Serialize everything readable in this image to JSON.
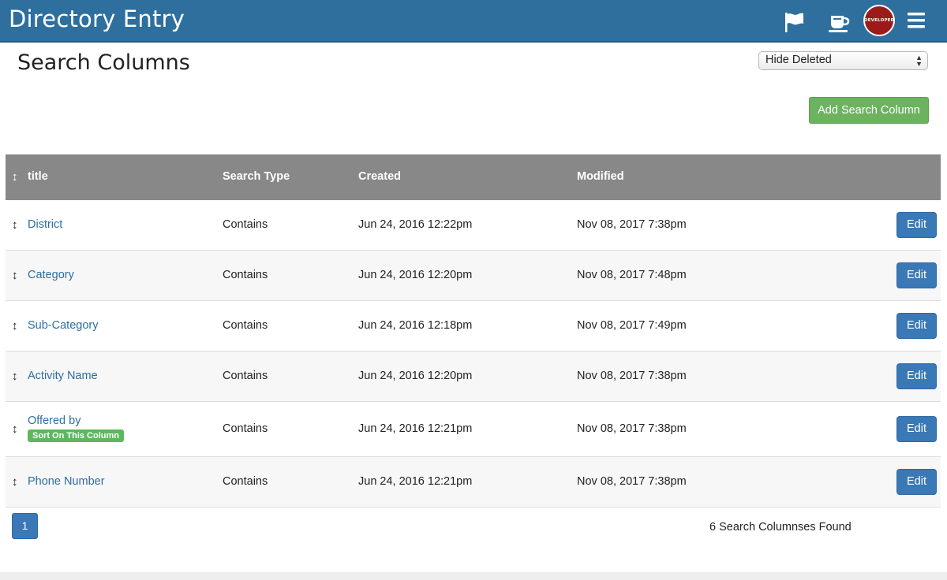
{
  "header": {
    "title": "Directory Entry",
    "icons": [
      "flag-icon",
      "coffee-cup-icon",
      "menu-icon"
    ],
    "avatar_text": "DEVELOPER",
    "bar_color": "#2e6f9e"
  },
  "page": {
    "title": "Search Columns",
    "filter": {
      "selected": "Hide Deleted"
    },
    "add_button": "Add Search Column"
  },
  "table": {
    "columns": [
      "title",
      "Search Type",
      "Created",
      "Modified"
    ],
    "rows": [
      {
        "title": "District",
        "type": "Contains",
        "created": "Jun 24, 2016 12:22pm",
        "modified": "Nov 08, 2017 7:38pm",
        "edit": "Edit"
      },
      {
        "title": "Category",
        "type": "Contains",
        "created": "Jun 24, 2016 12:20pm",
        "modified": "Nov 08, 2017 7:48pm",
        "edit": "Edit"
      },
      {
        "title": "Sub-Category",
        "type": "Contains",
        "created": "Jun 24, 2016 12:18pm",
        "modified": "Nov 08, 2017 7:49pm",
        "edit": "Edit"
      },
      {
        "title": "Activity Name",
        "type": "Contains",
        "created": "Jun 24, 2016 12:20pm",
        "modified": "Nov 08, 2017 7:38pm",
        "edit": "Edit"
      },
      {
        "title": "Offered by",
        "badge": "Sort On This Column",
        "type": "Contains",
        "created": "Jun 24, 2016 12:21pm",
        "modified": "Nov 08, 2017 7:38pm",
        "edit": "Edit"
      },
      {
        "title": "Phone Number",
        "type": "Contains",
        "created": "Jun 24, 2016 12:21pm",
        "modified": "Nov 08, 2017 7:38pm",
        "edit": "Edit"
      }
    ]
  },
  "footer": {
    "page": "1",
    "found": "6 Search Columnses Found"
  },
  "colors": {
    "accent": "#3a78b6",
    "success": "#6cb35f",
    "table_header": "#888888",
    "link": "#2d6da3"
  }
}
